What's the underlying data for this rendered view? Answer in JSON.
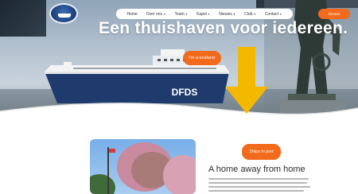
{
  "nav": {
    "items": [
      {
        "label": "Home",
        "has_dropdown": false
      },
      {
        "label": "Over ons",
        "has_dropdown": true
      },
      {
        "label": "Team",
        "has_dropdown": true
      },
      {
        "label": "Kapel",
        "has_dropdown": true
      },
      {
        "label": "Nieuws",
        "has_dropdown": true
      },
      {
        "label": "Club",
        "has_dropdown": true
      },
      {
        "label": "Contact",
        "has_dropdown": true
      }
    ],
    "cta_label": "Doneer"
  },
  "hero": {
    "headline": "Een thuishaven voor iedereen.",
    "cta_label": "I'm a seafarer",
    "ship_name": "DFDS"
  },
  "about": {
    "ships_button": "Ships in port",
    "title": "A home away from home"
  },
  "colors": {
    "accent": "#f26a1b",
    "annotation_arrow": "#f5b800"
  }
}
